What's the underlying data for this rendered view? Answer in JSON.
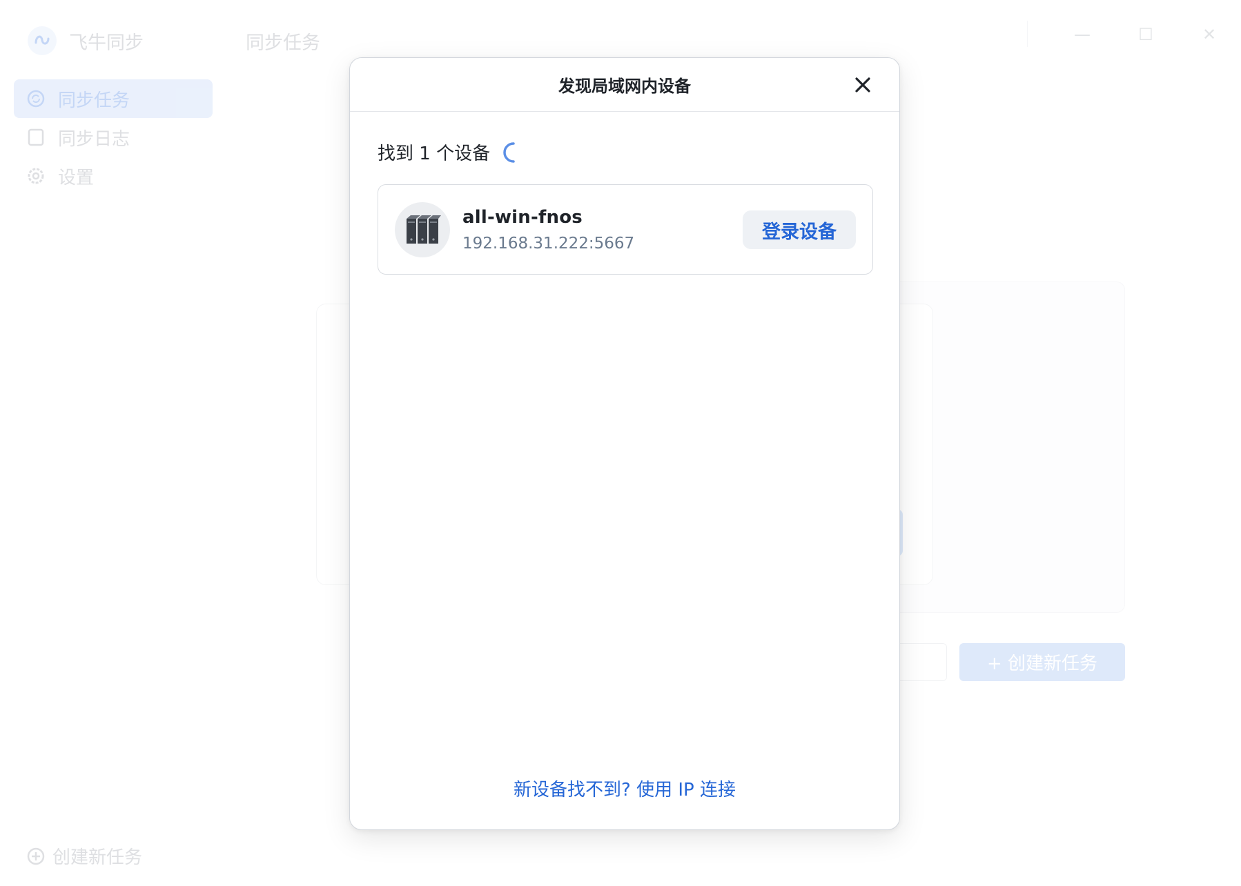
{
  "app": {
    "name": "飞牛同步",
    "page_title": "同步任务"
  },
  "sidebar": {
    "items": [
      {
        "label": "同步任务",
        "icon": "sync-icon",
        "active": true
      },
      {
        "label": "同步日志",
        "icon": "log-icon",
        "active": false
      },
      {
        "label": "设置",
        "icon": "gear-icon",
        "active": false
      }
    ],
    "bottom_label": "创建新任务"
  },
  "background": {
    "create_button_label": "+ 创建新任务"
  },
  "modal": {
    "title": "发现局域网内设备",
    "found_text": "找到 1 个设备",
    "devices": [
      {
        "name": "all-win-fnos",
        "address": "192.168.31.222:5667",
        "icon": "server-icon",
        "action_label": "登录设备"
      }
    ],
    "ip_link_label": "新设备找不到? 使用 IP 连接"
  },
  "colors": {
    "accent": "#2566d6",
    "sidebar_active_bg": "#b5cdf5",
    "button_bg": "#eef1f5"
  }
}
